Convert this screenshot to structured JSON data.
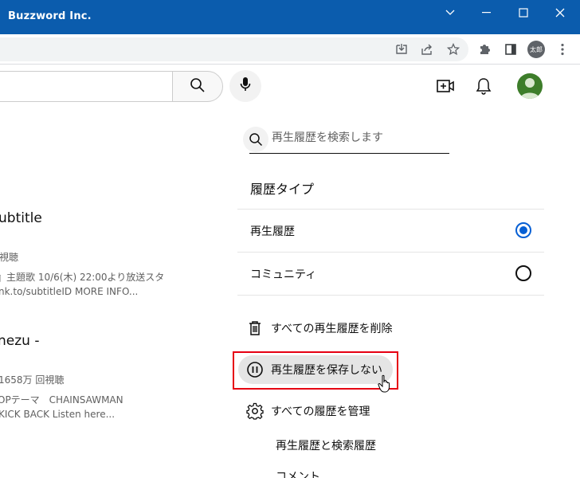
{
  "window": {
    "title": "Buzzword Inc.",
    "controls": [
      "chevron-down-icon",
      "minimize-icon",
      "maximize-icon",
      "close-icon"
    ],
    "colors": {
      "titlebar": "#0b5cad"
    }
  },
  "browser": {
    "toolbar_icons": [
      "install-app-icon",
      "share-icon",
      "star-icon",
      "extensions-icon",
      "side-panel-icon"
    ],
    "profile_label": "太郎"
  },
  "youtube_header": {
    "icons": [
      "search-icon",
      "mic-icon",
      "create-video-icon",
      "notifications-icon",
      "account-avatar"
    ]
  },
  "videos": [
    {
      "title": "ubtitle",
      "meta": "視聴",
      "desc_line1": "』主題歌 10/6(木) 22:00より放送スタ",
      "desc_line2": "nk.to/subtitleID MORE INFO..."
    },
    {
      "title": "nezu -",
      "meta": "1658万 回視聴",
      "desc_line1": "OPテーマ　CHAINSAWMAN",
      "desc_line2": "KICK BACK Listen here..."
    }
  ],
  "history_panel": {
    "search_placeholder": "再生履歴を検索します",
    "section_title": "履歴タイプ",
    "options": [
      {
        "label": "再生履歴",
        "selected": true
      },
      {
        "label": "コミュニティ",
        "selected": false
      }
    ],
    "actions": {
      "clear": "すべての再生履歴を削除",
      "pause": "再生履歴を保存しない",
      "manage": "すべての履歴を管理"
    },
    "sub_links": [
      "再生履歴と検索履歴",
      "コメント"
    ],
    "colors": {
      "accent": "#065fd4",
      "highlight": "#e60012"
    }
  }
}
